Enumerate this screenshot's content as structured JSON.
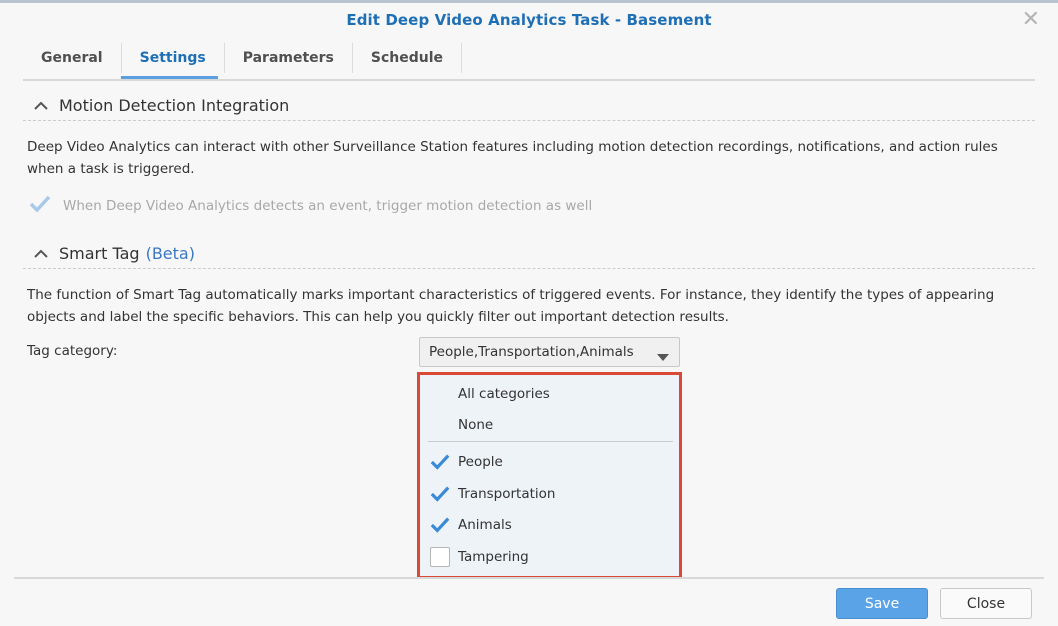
{
  "dialog": {
    "title": "Edit Deep Video Analytics Task - Basement",
    "close_icon": "close-icon"
  },
  "tabs": [
    {
      "label": "General",
      "active": false
    },
    {
      "label": "Settings",
      "active": true
    },
    {
      "label": "Parameters",
      "active": false
    },
    {
      "label": "Schedule",
      "active": false
    }
  ],
  "motion": {
    "title": "Motion Detection Integration",
    "description": "Deep Video Analytics can interact with other Surveillance Station features including motion detection recordings, notifications, and action rules when a task is triggered.",
    "checkbox_label": "When Deep Video Analytics detects an event, trigger motion detection as well",
    "checkbox_checked": true,
    "checkbox_disabled": true
  },
  "smart_tag": {
    "title": "Smart Tag",
    "beta": "(Beta)",
    "description": "The function of Smart Tag automatically marks important characteristics of triggered events. For instance, they identify the types of appearing objects and label the specific behaviors. This can help you quickly filter out important detection results.",
    "category_label": "Tag category:",
    "selected_value": "People,Transportation,Animals"
  },
  "dropdown": {
    "options_top": [
      "All categories",
      "None"
    ],
    "options": [
      {
        "label": "People",
        "checked": true
      },
      {
        "label": "Transportation",
        "checked": true
      },
      {
        "label": "Animals",
        "checked": true
      },
      {
        "label": "Tampering",
        "checked": false
      }
    ]
  },
  "footer": {
    "save_label": "Save",
    "close_label": "Close"
  },
  "colors": {
    "accent": "#1f6fb5",
    "highlight_border": "#d94a36",
    "save_button": "#5aa3e6"
  }
}
